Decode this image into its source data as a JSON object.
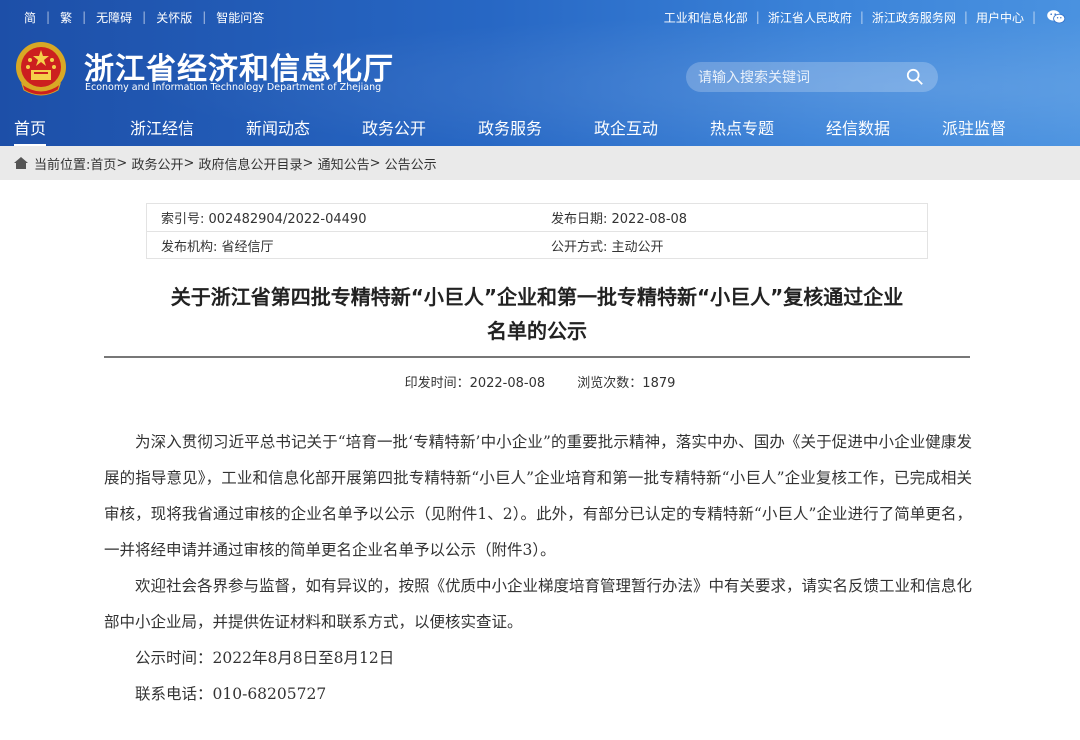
{
  "topbar": {
    "left_links": [
      "简",
      "繁",
      "无障碍",
      "关怀版",
      "智能问答"
    ],
    "right_links": [
      "工业和信息化部",
      "浙江省人民政府",
      "浙江政务服务网",
      "用户中心"
    ]
  },
  "header": {
    "title": "浙江省经济和信息化厅",
    "subtitle": "Economy and Information Technology Department of Zhejiang",
    "search_placeholder": "请输入搜索关键词"
  },
  "nav": {
    "items": [
      "首页",
      "浙江经信",
      "新闻动态",
      "政务公开",
      "政务服务",
      "政企互动",
      "热点专题",
      "经信数据",
      "派驻监督"
    ],
    "active": "首页"
  },
  "breadcrumb": {
    "label": "当前位置:",
    "items": [
      "首页",
      "政务公开",
      "政府信息公开目录",
      "通知公告",
      "公告公示"
    ],
    "sep": ">"
  },
  "meta": {
    "index_no": "索引号: 002482904/2022-04490",
    "publish_date": "发布日期: 2022-08-08",
    "issuer": "发布机构: 省经信厅",
    "open_mode": "公开方式: 主动公开"
  },
  "article": {
    "title_line1": "关于浙江省第四批专精特新“小巨人”企业和第一批专精特新“小巨人”复核通过企业",
    "title_line2": "名单的公示",
    "print_time": "印发时间：2022-08-08",
    "views": "浏览次数：1879",
    "paragraphs": [
      "为深入贯彻习近平总书记关于“培育一批‘专精特新’中小企业”的重要批示精神，落实中办、国办《关于促进中小企业健康发展的指导意见》，工业和信息化部开展第四批专精特新“小巨人”企业培育和第一批专精特新“小巨人”企业复核工作，已完成相关审核，现将我省通过审核的企业名单予以公示（见附件1、2）。此外，有部分已认定的专精特新“小巨人”企业进行了简单更名，一并将经申请并通过审核的简单更名企业名单予以公示（附件3）。",
      "欢迎社会各界参与监督，如有异议的，按照《优质中小企业梯度培育管理暂行办法》中有关要求，请实名反馈工业和信息化部中小企业局，并提供佐证材料和联系方式，以便核实查证。",
      "公示时间：2022年8月8日至8月12日",
      "联系电话：010-68205727"
    ]
  },
  "colors": {
    "header_start": "#1d4fa8",
    "header_end": "#4a92e0",
    "breadcrumb_bg": "#eaeaea"
  }
}
